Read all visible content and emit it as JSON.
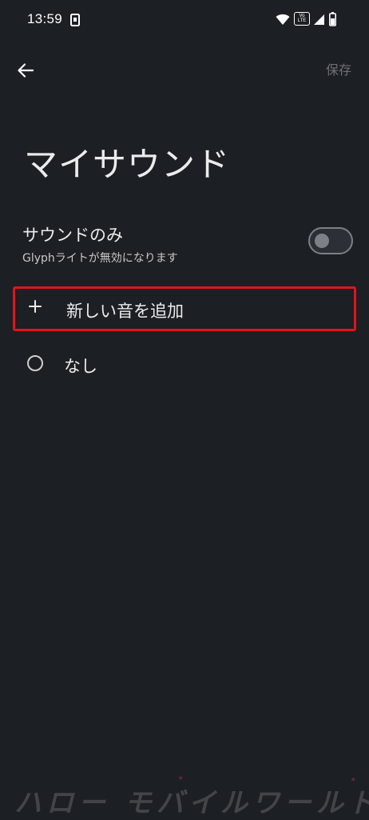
{
  "status_bar": {
    "time": "13:59",
    "volte_label_top": "Vo",
    "volte_label_bottom": "LTE"
  },
  "header": {
    "save_label": "保存"
  },
  "page": {
    "title": "マイサウンド"
  },
  "sound_only": {
    "title": "サウンドのみ",
    "subtitle": "Glyphライトが無効になります",
    "enabled": false
  },
  "options": {
    "add_new_label": "新しい音を追加",
    "none_label": "なし"
  },
  "watermark": {
    "text": "ハロー モバイルワールド"
  },
  "colors": {
    "background": "#1c1f23",
    "highlight_border": "#e0141c",
    "disabled_text": "#6e7075"
  }
}
